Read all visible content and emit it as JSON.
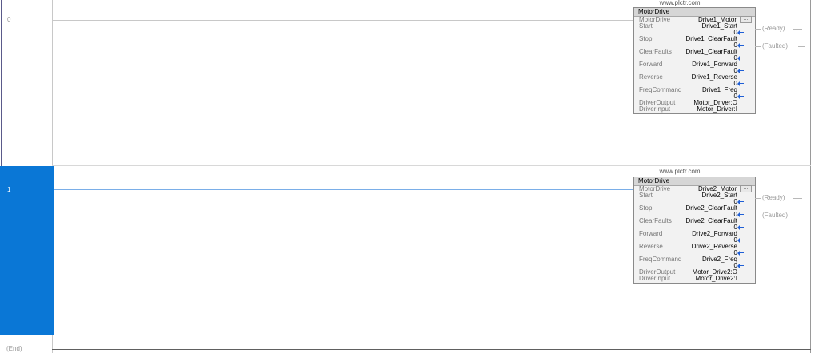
{
  "rungs": [
    {
      "number": "0",
      "website": "www.plctr.com",
      "instruction": {
        "name": "MotorDrive",
        "params": [
          {
            "name": "MotorDrive",
            "tag": "Drive1_Motor"
          },
          {
            "name": "Start",
            "tag": "Drive1_Start",
            "value": "0"
          },
          {
            "name": "Stop",
            "tag": "Drive1_ClearFault",
            "value": "0"
          },
          {
            "name": "ClearFaults",
            "tag": "Drive1_ClearFault",
            "value": "0"
          },
          {
            "name": "Forward",
            "tag": "Drive1_Forward",
            "value": "0"
          },
          {
            "name": "Reverse",
            "tag": "Drive1_Reverse",
            "value": "0"
          },
          {
            "name": "FreqCommand",
            "tag": "Drive1_Freq",
            "value": "0"
          },
          {
            "name": "DriverOutput",
            "tag": "Motor_Driver:O"
          },
          {
            "name": "DriverInput",
            "tag": "Motor_Driver:I"
          }
        ]
      },
      "outputs": [
        "Ready",
        "Faulted"
      ]
    },
    {
      "number": "1",
      "website": "www.plctr.com",
      "instruction": {
        "name": "MotorDrive",
        "params": [
          {
            "name": "MotorDrive",
            "tag": "Drive2_Motor"
          },
          {
            "name": "Start",
            "tag": "Drive2_Start",
            "value": "0"
          },
          {
            "name": "Stop",
            "tag": "Drive2_ClearFault",
            "value": "0"
          },
          {
            "name": "ClearFaults",
            "tag": "Drive2_ClearFault",
            "value": "0"
          },
          {
            "name": "Forward",
            "tag": "Drive2_Forward",
            "value": "0"
          },
          {
            "name": "Reverse",
            "tag": "Drive2_Reverse",
            "value": "0"
          },
          {
            "name": "FreqCommand",
            "tag": "Drive2_Freq",
            "value": "0"
          },
          {
            "name": "DriverOutput",
            "tag": "Motor_Drive2:O"
          },
          {
            "name": "DriverInput",
            "tag": "Motor_Drive2:I"
          }
        ]
      },
      "outputs": [
        "Ready",
        "Faulted"
      ]
    }
  ],
  "end_label": "(End)",
  "ellipsis_glyph": "...",
  "colors": {
    "selection": "#0a77d6",
    "rung_wire": "#c8c8c8",
    "selected_wire": "#7aaee8",
    "value_arrow": "#1f5fd6"
  }
}
